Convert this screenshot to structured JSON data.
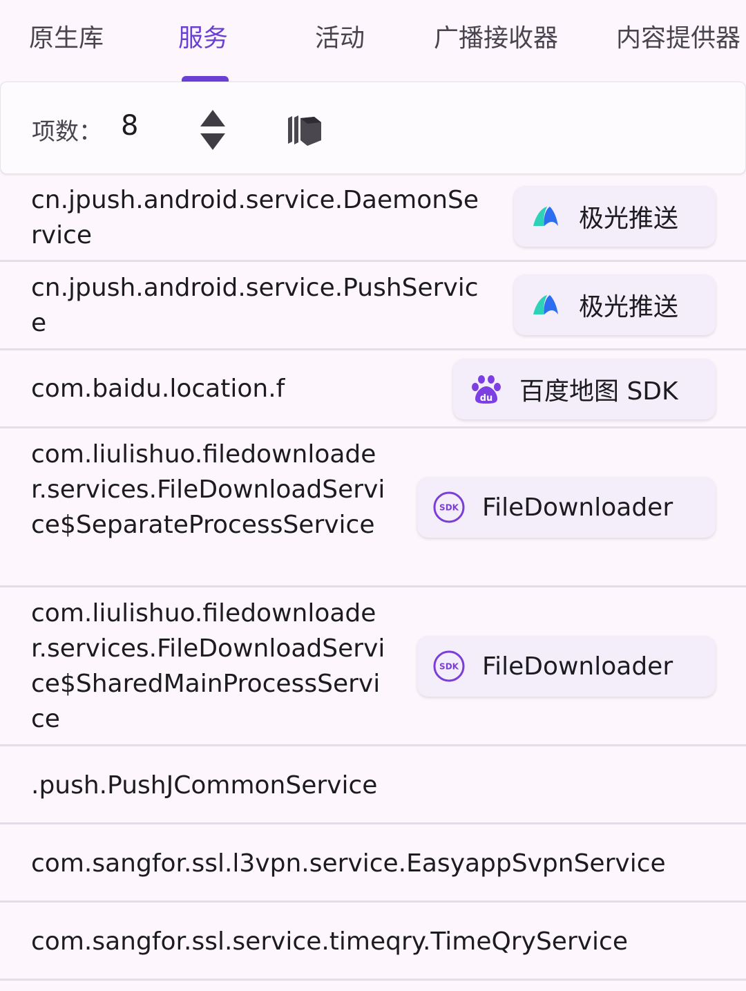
{
  "tabs": [
    {
      "label": "原生库",
      "active": false
    },
    {
      "label": "服务",
      "active": true
    },
    {
      "label": "活动",
      "active": false
    },
    {
      "label": "广播接收器",
      "active": false
    },
    {
      "label": "内容提供器",
      "active": false
    }
  ],
  "toolbar": {
    "count_label": "项数：",
    "count_value": "8",
    "sort_icon": "sort-up-down-icon",
    "layers_icon": "stacked-layers-icon"
  },
  "services": [
    {
      "name": "cn.jpush.android.service.DaemonService",
      "sdk": {
        "label": "极光推送",
        "icon": "jpush-logo-icon"
      }
    },
    {
      "name": "cn.jpush.android.service.PushService",
      "sdk": {
        "label": "极光推送",
        "icon": "jpush-logo-icon"
      }
    },
    {
      "name": "com.baidu.location.f",
      "sdk": {
        "label": "百度地图 SDK",
        "icon": "baidu-paw-icon"
      }
    },
    {
      "name": "com.liulishuo.filedownloader.services.FileDownloadService$SeparateProcessService",
      "sdk": {
        "label": "FileDownloader",
        "icon": "sdk-badge-icon"
      }
    },
    {
      "name": "com.liulishuo.filedownloader.services.FileDownloadService$SharedMainProcessService",
      "sdk": {
        "label": "FileDownloader",
        "icon": "sdk-badge-icon"
      }
    },
    {
      "name": ".push.PushJCommonService"
    },
    {
      "name": "com.sangfor.ssl.l3vpn.service.EasyappSvpnService"
    },
    {
      "name": "com.sangfor.ssl.service.timeqry.TimeQryService"
    }
  ],
  "colors": {
    "accent": "#6b3fd4",
    "chip_bg": "#f3eefa",
    "sdk_purple": "#7c3fd6",
    "baidu_purple": "#7b3fe4",
    "jpush_teal": "#2ed3b7",
    "jpush_blue": "#2f6df0"
  }
}
